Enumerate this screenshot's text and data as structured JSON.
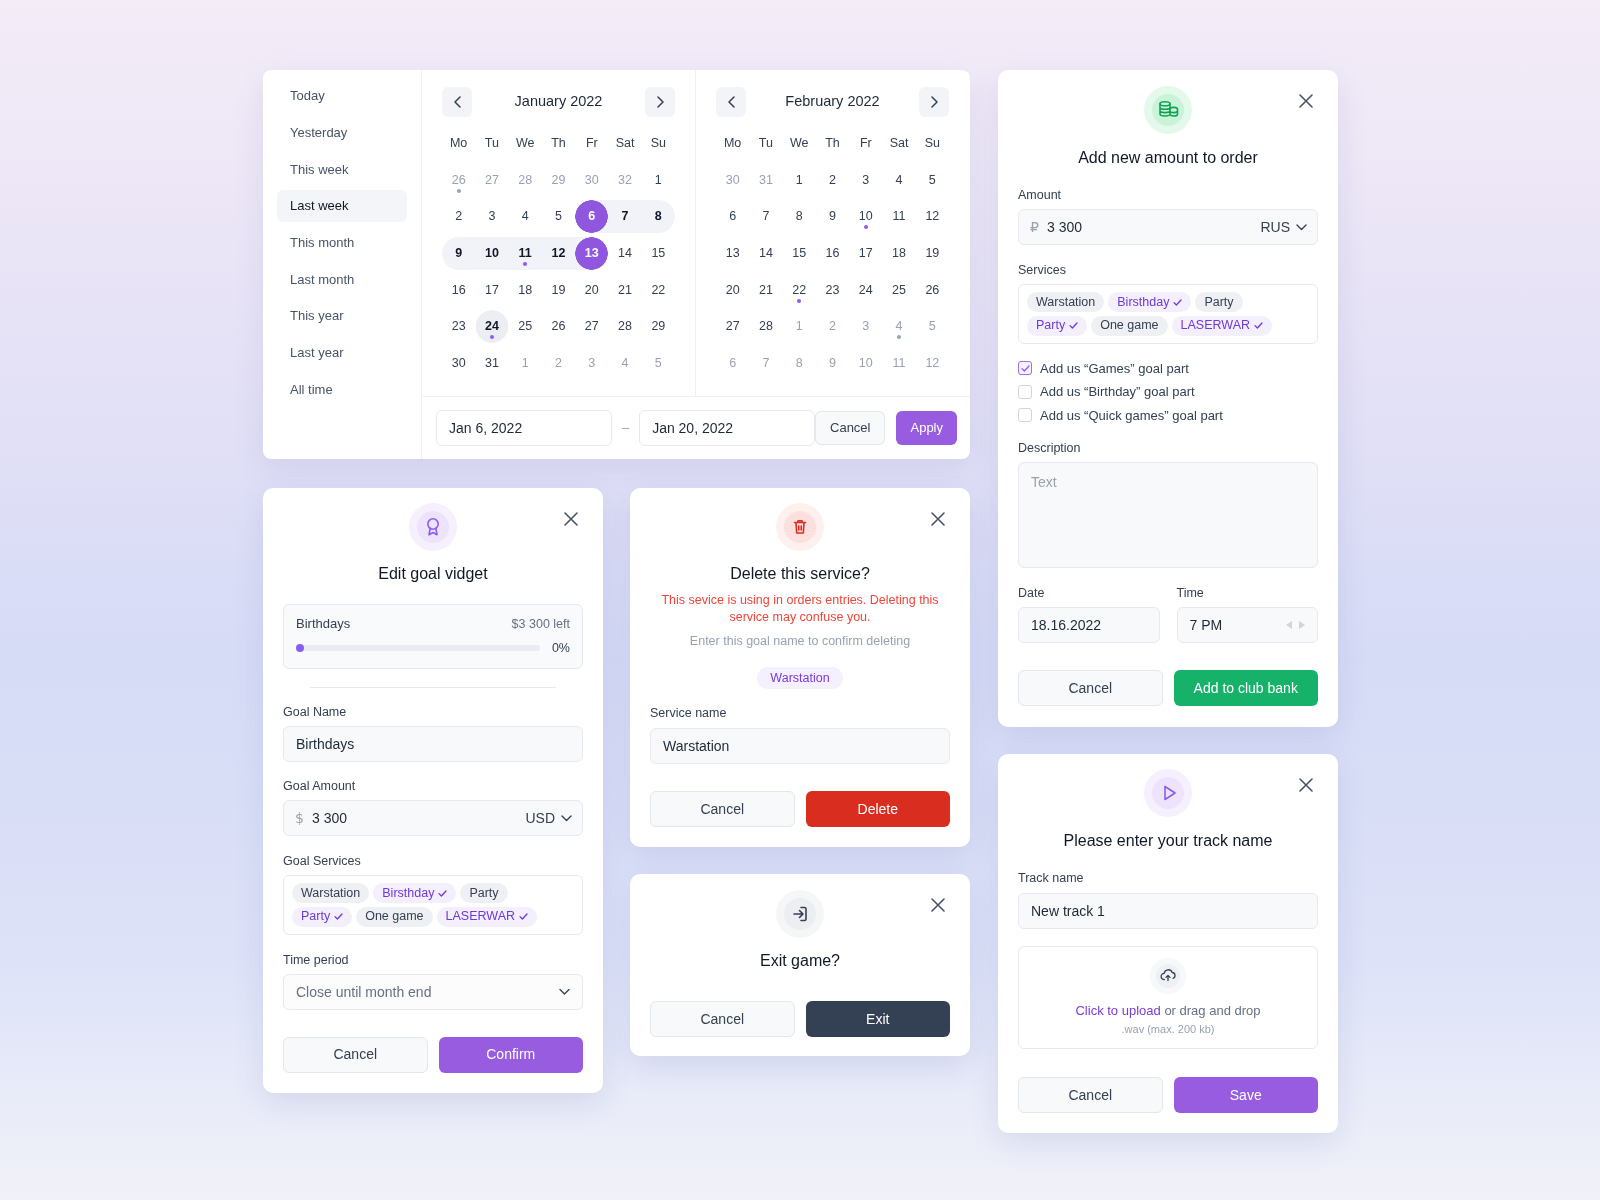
{
  "date_range_picker": {
    "presets": [
      {
        "label": "Today",
        "selected": false
      },
      {
        "label": "Yesterday",
        "selected": false
      },
      {
        "label": "This week",
        "selected": false
      },
      {
        "label": "Last week",
        "selected": true
      },
      {
        "label": "This month",
        "selected": false
      },
      {
        "label": "Last month",
        "selected": false
      },
      {
        "label": "This year",
        "selected": false
      },
      {
        "label": "Last year",
        "selected": false
      },
      {
        "label": "All time",
        "selected": false
      }
    ],
    "months": [
      {
        "title": "January 2022",
        "weekdays": [
          "Mo",
          "Tu",
          "We",
          "Th",
          "Fr",
          "Sat",
          "Su"
        ],
        "weeks": [
          [
            {
              "label": "26",
              "kind": "outside",
              "selected": false,
              "in_range": false,
              "marked": true
            },
            {
              "label": "27",
              "kind": "outside",
              "selected": false,
              "in_range": false,
              "marked": false
            },
            {
              "label": "28",
              "kind": "outside",
              "selected": false,
              "in_range": false,
              "marked": false
            },
            {
              "label": "29",
              "kind": "outside",
              "selected": false,
              "in_range": false,
              "marked": false
            },
            {
              "label": "30",
              "kind": "outside",
              "selected": false,
              "in_range": false,
              "marked": false
            },
            {
              "label": "32",
              "kind": "outside",
              "selected": false,
              "in_range": false,
              "marked": false
            },
            {
              "label": "1",
              "kind": "current",
              "selected": false,
              "in_range": false,
              "marked": false
            }
          ],
          [
            {
              "label": "2",
              "kind": "current",
              "selected": false,
              "in_range": false,
              "marked": false
            },
            {
              "label": "3",
              "kind": "current",
              "selected": false,
              "in_range": false,
              "marked": false
            },
            {
              "label": "4",
              "kind": "current",
              "selected": false,
              "in_range": false,
              "marked": false
            },
            {
              "label": "5",
              "kind": "current",
              "selected": false,
              "in_range": false,
              "marked": false
            },
            {
              "label": "6",
              "kind": "current",
              "selected": true,
              "in_range": true,
              "marked": false
            },
            {
              "label": "7",
              "kind": "current",
              "selected": false,
              "in_range": true,
              "marked": false
            },
            {
              "label": "8",
              "kind": "current",
              "selected": false,
              "in_range": true,
              "marked": false
            }
          ],
          [
            {
              "label": "9",
              "kind": "current",
              "selected": false,
              "in_range": true,
              "marked": false
            },
            {
              "label": "10",
              "kind": "current",
              "selected": false,
              "in_range": true,
              "marked": false
            },
            {
              "label": "11",
              "kind": "current",
              "selected": false,
              "in_range": true,
              "marked": true
            },
            {
              "label": "12",
              "kind": "current",
              "selected": false,
              "in_range": true,
              "marked": false
            },
            {
              "label": "13",
              "kind": "current",
              "selected": true,
              "in_range": true,
              "marked": false
            },
            {
              "label": "14",
              "kind": "current",
              "selected": false,
              "in_range": false,
              "marked": false
            },
            {
              "label": "15",
              "kind": "current",
              "selected": false,
              "in_range": false,
              "marked": false
            }
          ],
          [
            {
              "label": "16",
              "kind": "current",
              "selected": false,
              "in_range": false,
              "marked": false
            },
            {
              "label": "17",
              "kind": "current",
              "selected": false,
              "in_range": false,
              "marked": false
            },
            {
              "label": "18",
              "kind": "current",
              "selected": false,
              "in_range": false,
              "marked": false
            },
            {
              "label": "19",
              "kind": "current",
              "selected": false,
              "in_range": false,
              "marked": false
            },
            {
              "label": "20",
              "kind": "current",
              "selected": false,
              "in_range": false,
              "marked": false
            },
            {
              "label": "21",
              "kind": "current",
              "selected": false,
              "in_range": false,
              "marked": false
            },
            {
              "label": "22",
              "kind": "current",
              "selected": false,
              "in_range": false,
              "marked": false
            }
          ],
          [
            {
              "label": "23",
              "kind": "current",
              "selected": false,
              "in_range": false,
              "marked": false
            },
            {
              "label": "24",
              "kind": "today",
              "selected": false,
              "in_range": false,
              "marked": true
            },
            {
              "label": "25",
              "kind": "current",
              "selected": false,
              "in_range": false,
              "marked": false
            },
            {
              "label": "26",
              "kind": "current",
              "selected": false,
              "in_range": false,
              "marked": false
            },
            {
              "label": "27",
              "kind": "current",
              "selected": false,
              "in_range": false,
              "marked": false
            },
            {
              "label": "28",
              "kind": "current",
              "selected": false,
              "in_range": false,
              "marked": false
            },
            {
              "label": "29",
              "kind": "current",
              "selected": false,
              "in_range": false,
              "marked": false
            }
          ],
          [
            {
              "label": "30",
              "kind": "current",
              "selected": false,
              "in_range": false,
              "marked": false
            },
            {
              "label": "31",
              "kind": "current",
              "selected": false,
              "in_range": false,
              "marked": false
            },
            {
              "label": "1",
              "kind": "outside",
              "selected": false,
              "in_range": false,
              "marked": false
            },
            {
              "label": "2",
              "kind": "outside",
              "selected": false,
              "in_range": false,
              "marked": false
            },
            {
              "label": "3",
              "kind": "outside",
              "selected": false,
              "in_range": false,
              "marked": false
            },
            {
              "label": "4",
              "kind": "outside",
              "selected": false,
              "in_range": false,
              "marked": false
            },
            {
              "label": "5",
              "kind": "outside",
              "selected": false,
              "in_range": false,
              "marked": false
            }
          ]
        ]
      },
      {
        "title": "February 2022",
        "weekdays": [
          "Mo",
          "Tu",
          "We",
          "Th",
          "Fr",
          "Sat",
          "Su"
        ],
        "weeks": [
          [
            {
              "label": "30",
              "kind": "outside",
              "selected": false,
              "in_range": false,
              "marked": false
            },
            {
              "label": "31",
              "kind": "outside",
              "selected": false,
              "in_range": false,
              "marked": false
            },
            {
              "label": "1",
              "kind": "current",
              "selected": false,
              "in_range": false,
              "marked": false
            },
            {
              "label": "2",
              "kind": "current",
              "selected": false,
              "in_range": false,
              "marked": false
            },
            {
              "label": "3",
              "kind": "current",
              "selected": false,
              "in_range": false,
              "marked": false
            },
            {
              "label": "4",
              "kind": "current",
              "selected": false,
              "in_range": false,
              "marked": false
            },
            {
              "label": "5",
              "kind": "current",
              "selected": false,
              "in_range": false,
              "marked": false
            }
          ],
          [
            {
              "label": "6",
              "kind": "current",
              "selected": false,
              "in_range": false,
              "marked": false
            },
            {
              "label": "7",
              "kind": "current",
              "selected": false,
              "in_range": false,
              "marked": false
            },
            {
              "label": "8",
              "kind": "current",
              "selected": false,
              "in_range": false,
              "marked": false
            },
            {
              "label": "9",
              "kind": "current",
              "selected": false,
              "in_range": false,
              "marked": false
            },
            {
              "label": "10",
              "kind": "current",
              "selected": false,
              "in_range": false,
              "marked": true
            },
            {
              "label": "11",
              "kind": "current",
              "selected": false,
              "in_range": false,
              "marked": false
            },
            {
              "label": "12",
              "kind": "current",
              "selected": false,
              "in_range": false,
              "marked": false
            }
          ],
          [
            {
              "label": "13",
              "kind": "current",
              "selected": false,
              "in_range": false,
              "marked": false
            },
            {
              "label": "14",
              "kind": "current",
              "selected": false,
              "in_range": false,
              "marked": false
            },
            {
              "label": "15",
              "kind": "current",
              "selected": false,
              "in_range": false,
              "marked": false
            },
            {
              "label": "16",
              "kind": "current",
              "selected": false,
              "in_range": false,
              "marked": false
            },
            {
              "label": "17",
              "kind": "current",
              "selected": false,
              "in_range": false,
              "marked": false
            },
            {
              "label": "18",
              "kind": "current",
              "selected": false,
              "in_range": false,
              "marked": false
            },
            {
              "label": "19",
              "kind": "current",
              "selected": false,
              "in_range": false,
              "marked": false
            }
          ],
          [
            {
              "label": "20",
              "kind": "current",
              "selected": false,
              "in_range": false,
              "marked": false
            },
            {
              "label": "21",
              "kind": "current",
              "selected": false,
              "in_range": false,
              "marked": false
            },
            {
              "label": "22",
              "kind": "current",
              "selected": false,
              "in_range": false,
              "marked": true
            },
            {
              "label": "23",
              "kind": "current",
              "selected": false,
              "in_range": false,
              "marked": false
            },
            {
              "label": "24",
              "kind": "current",
              "selected": false,
              "in_range": false,
              "marked": false
            },
            {
              "label": "25",
              "kind": "current",
              "selected": false,
              "in_range": false,
              "marked": false
            },
            {
              "label": "26",
              "kind": "current",
              "selected": false,
              "in_range": false,
              "marked": false
            }
          ],
          [
            {
              "label": "27",
              "kind": "current",
              "selected": false,
              "in_range": false,
              "marked": false
            },
            {
              "label": "28",
              "kind": "current",
              "selected": false,
              "in_range": false,
              "marked": false
            },
            {
              "label": "1",
              "kind": "outside",
              "selected": false,
              "in_range": false,
              "marked": false
            },
            {
              "label": "2",
              "kind": "outside",
              "selected": false,
              "in_range": false,
              "marked": false
            },
            {
              "label": "3",
              "kind": "outside",
              "selected": false,
              "in_range": false,
              "marked": false
            },
            {
              "label": "4",
              "kind": "outside",
              "selected": false,
              "in_range": false,
              "marked": true
            },
            {
              "label": "5",
              "kind": "outside",
              "selected": false,
              "in_range": false,
              "marked": false
            }
          ],
          [
            {
              "label": "6",
              "kind": "outside",
              "selected": false,
              "in_range": false,
              "marked": false
            },
            {
              "label": "7",
              "kind": "outside",
              "selected": false,
              "in_range": false,
              "marked": false
            },
            {
              "label": "8",
              "kind": "outside",
              "selected": false,
              "in_range": false,
              "marked": false
            },
            {
              "label": "9",
              "kind": "outside",
              "selected": false,
              "in_range": false,
              "marked": false
            },
            {
              "label": "10",
              "kind": "outside",
              "selected": false,
              "in_range": false,
              "marked": false
            },
            {
              "label": "11",
              "kind": "outside",
              "selected": false,
              "in_range": false,
              "marked": false
            },
            {
              "label": "12",
              "kind": "outside",
              "selected": false,
              "in_range": false,
              "marked": false
            }
          ]
        ]
      }
    ],
    "start_date": "Jan 6, 2022",
    "separator": "–",
    "end_date": "Jan 20, 2022",
    "buttons": [
      {
        "label": "Cancel",
        "kind": "secondary"
      },
      {
        "label": "Apply",
        "kind": "primary"
      }
    ]
  },
  "add_amount_dialog": {
    "title": "Add new amount to order",
    "amount": {
      "label": "Amount",
      "currency_symbol": "₽",
      "value": "3 300",
      "currency": "RUS"
    },
    "services": {
      "label": "Services",
      "tags": [
        {
          "label": "Warstation",
          "selected": false
        },
        {
          "label": "Birsthday",
          "selected": true
        },
        {
          "label": "Party",
          "selected": false
        },
        {
          "label": "Party",
          "selected": true
        },
        {
          "label": "One game",
          "selected": false
        },
        {
          "label": "LASERWAR",
          "selected": true
        }
      ]
    },
    "options": [
      {
        "label": "Add us “Games” goal part",
        "checked": true
      },
      {
        "label": "Add us “Birthday” goal part",
        "checked": false
      },
      {
        "label": "Add us “Quick games” goal part",
        "checked": false
      }
    ],
    "description": {
      "label": "Description",
      "placeholder": "Text"
    },
    "date": {
      "label": "Date",
      "value": "18.16.2022"
    },
    "time": {
      "label": "Time",
      "value": "7 PM"
    },
    "buttons": [
      {
        "label": "Cancel",
        "kind": "secondary"
      },
      {
        "label": "Add to club bank",
        "kind": "success"
      }
    ]
  },
  "edit_goal_dialog": {
    "title": "Edit goal vidget",
    "goal": {
      "name": "Birthdays",
      "remaining": "$3 300 left",
      "level": 0,
      "percent": "0%"
    },
    "goal_name": {
      "label": "Goal Name",
      "value": "Birthdays"
    },
    "goal_amount": {
      "label": "Goal Amount",
      "currency_symbol": "$",
      "value": "3 300",
      "currency": "USD"
    },
    "goal_services": {
      "label": "Goal Services",
      "tags": [
        {
          "label": "Warstation",
          "selected": false
        },
        {
          "label": "Birsthday",
          "selected": true
        },
        {
          "label": "Party",
          "selected": false
        },
        {
          "label": "Party",
          "selected": true
        },
        {
          "label": "One game",
          "selected": false
        },
        {
          "label": "LASERWAR",
          "selected": true
        }
      ]
    },
    "time_period": {
      "label": "Time period",
      "placeholder": "Close until month end"
    },
    "buttons": [
      {
        "label": "Cancel",
        "kind": "secondary"
      },
      {
        "label": "Confirm",
        "kind": "primary"
      }
    ]
  },
  "delete_service_dialog": {
    "title": "Delete this service?",
    "warning": "This sevice is using in orders entries. Deleting this service may confuse you.",
    "hint": "Enter this goal name to confirm deleting",
    "service_tag": "Warstation",
    "service_name": {
      "label": "Service name",
      "value": "Warstation"
    },
    "buttons": [
      {
        "label": "Cancel",
        "kind": "secondary"
      },
      {
        "label": "Delete",
        "kind": "danger"
      }
    ]
  },
  "exit_game_dialog": {
    "title": "Exit game?",
    "buttons": [
      {
        "label": "Cancel",
        "kind": "secondary"
      },
      {
        "label": "Exit",
        "kind": "dark"
      }
    ]
  },
  "track_name_dialog": {
    "title": "Please enter your track name",
    "track_name": {
      "label": "Track name",
      "value": "New track 1"
    },
    "upload": {
      "link": "Click to upload",
      "text": "or drag and drop",
      "note": ".wav (max. 200 kb)"
    },
    "buttons": [
      {
        "label": "Cancel",
        "kind": "secondary"
      },
      {
        "label": "Save",
        "kind": "primary"
      }
    ]
  }
}
